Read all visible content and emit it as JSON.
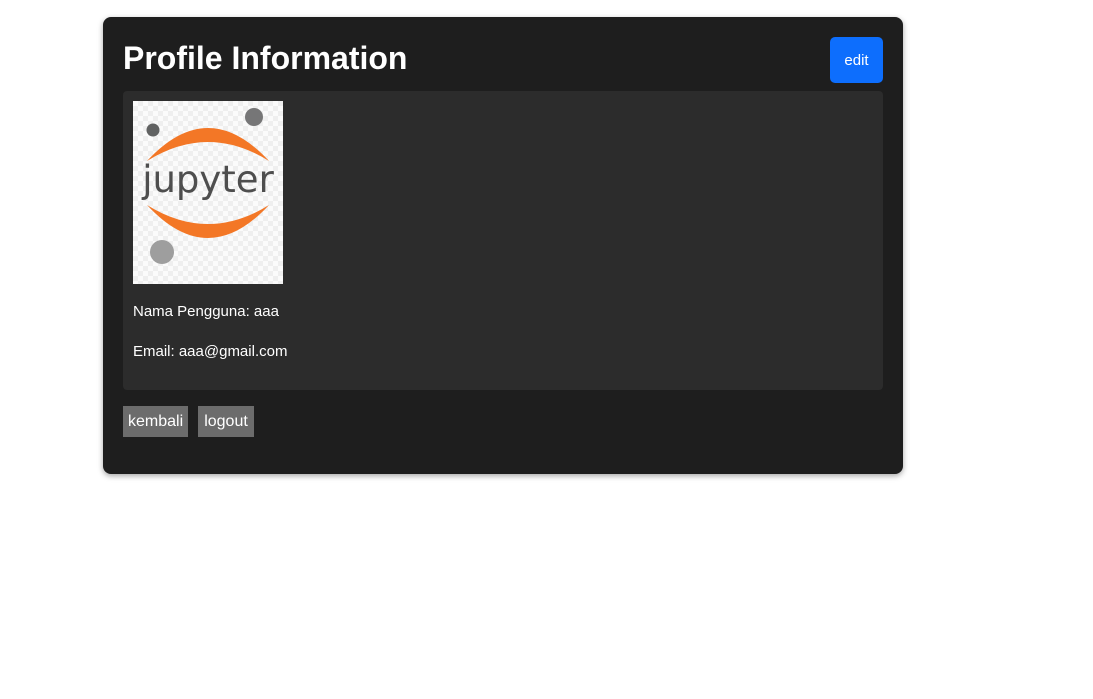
{
  "profile": {
    "title": "Profile Information",
    "edit_label": "edit",
    "avatar": {
      "icon": "jupyter-logo-icon",
      "logo_text": "jupyter",
      "colors": {
        "orange": "#f37726",
        "gray_text": "#4e4e4e",
        "dot_dark": "#767677",
        "dot_light": "#9e9e9e"
      }
    },
    "username_line": "Nama Pengguna: aaa",
    "email_line": "Email: aaa@gmail.com"
  },
  "actions": {
    "back_label": "kembali",
    "logout_label": "logout"
  },
  "colors": {
    "card_bg": "#1e1e1e",
    "panel_bg": "#2c2c2c",
    "primary": "#0d6efd",
    "secondary": "#6c6c6c",
    "text": "#ffffff"
  }
}
